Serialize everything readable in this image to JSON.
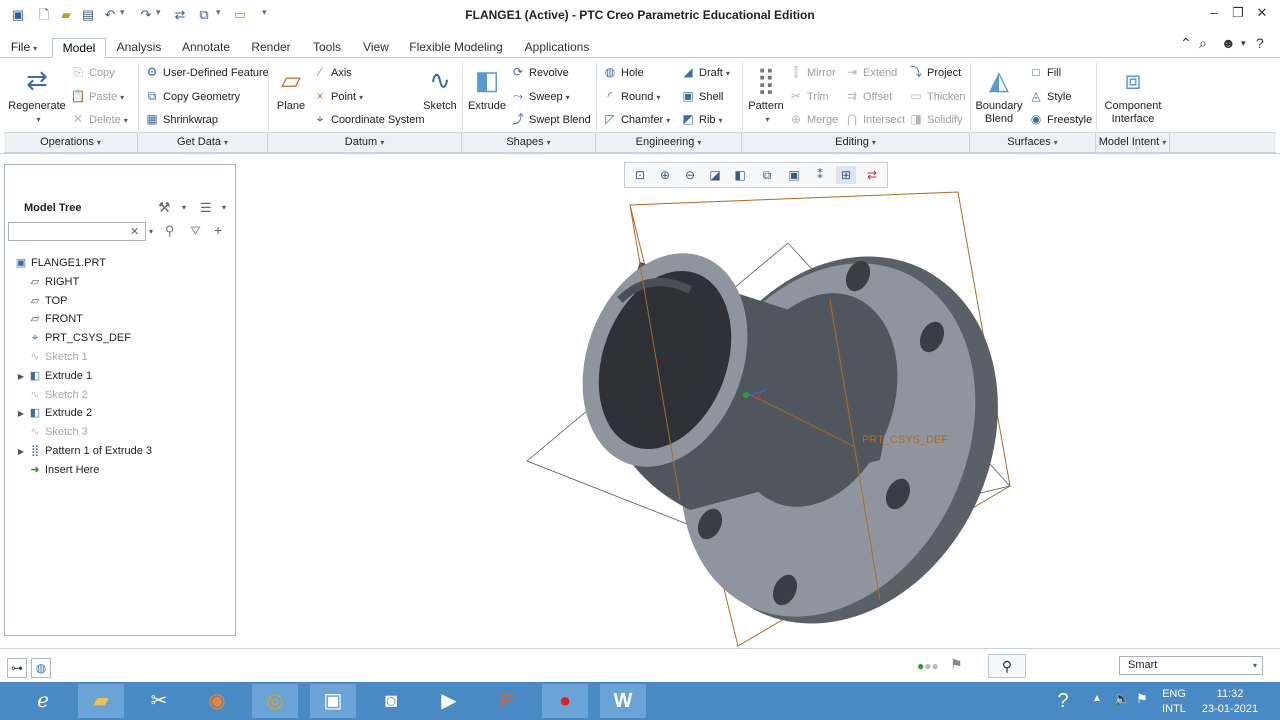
{
  "window": {
    "title": "FLANGE1 (Active) - PTC Creo Parametric Educational Edition"
  },
  "menu": {
    "file": "File"
  },
  "tabs": [
    "Model",
    "Analysis",
    "Annotate",
    "Render",
    "Tools",
    "View",
    "Flexible Modeling",
    "Applications"
  ],
  "ribbon": {
    "operations": {
      "regenerate": "Regenerate",
      "copy": "Copy",
      "paste": "Paste",
      "delete": "Delete"
    },
    "get_data": {
      "udf": "User-Defined Feature",
      "copy_geometry": "Copy Geometry",
      "shrinkwrap": "Shrinkwrap"
    },
    "datum": {
      "plane": "Plane",
      "axis": "Axis",
      "point": "Point",
      "csys": "Coordinate System",
      "sketch": "Sketch"
    },
    "shapes": {
      "extrude": "Extrude",
      "revolve": "Revolve",
      "sweep": "Sweep",
      "swept_blend": "Swept Blend"
    },
    "engineering": {
      "hole": "Hole",
      "round": "Round",
      "chamfer": "Chamfer",
      "draft": "Draft",
      "shell": "Shell",
      "rib": "Rib"
    },
    "editing": {
      "pattern": "Pattern",
      "mirror": "Mirror",
      "trim": "Trim",
      "merge": "Merge",
      "extend": "Extend",
      "offset": "Offset",
      "intersect": "Intersect",
      "project": "Project",
      "thicken": "Thicken",
      "solidify": "Solidify"
    },
    "surfaces": {
      "boundary_blend_1": "Boundary",
      "boundary_blend_2": "Blend",
      "fill": "Fill",
      "style": "Style",
      "freestyle": "Freestyle"
    },
    "model_intent": {
      "component_interface_1": "Component",
      "component_interface_2": "Interface"
    }
  },
  "groups": [
    "Operations",
    "Get Data",
    "Datum",
    "Shapes",
    "Engineering",
    "Editing",
    "Surfaces",
    "Model Intent"
  ],
  "model_tree": {
    "label": "Model Tree",
    "search_value": "",
    "items": [
      {
        "label": "FLANGE1.PRT",
        "icon": "part-icon",
        "dim": false,
        "expandable": false
      },
      {
        "label": "RIGHT",
        "icon": "datum-plane-icon",
        "dim": false,
        "expandable": false
      },
      {
        "label": "TOP",
        "icon": "datum-plane-icon",
        "dim": false,
        "expandable": false
      },
      {
        "label": "FRONT",
        "icon": "datum-plane-icon",
        "dim": false,
        "expandable": false
      },
      {
        "label": "PRT_CSYS_DEF",
        "icon": "csys-icon",
        "dim": false,
        "expandable": false
      },
      {
        "label": "Sketch 1",
        "icon": "sketch-icon",
        "dim": true,
        "expandable": false
      },
      {
        "label": "Extrude 1",
        "icon": "extrude-icon",
        "dim": false,
        "expandable": true
      },
      {
        "label": "Sketch 2",
        "icon": "sketch-icon",
        "dim": true,
        "expandable": false
      },
      {
        "label": "Extrude 2",
        "icon": "extrude-icon",
        "dim": false,
        "expandable": true
      },
      {
        "label": "Sketch 3",
        "icon": "sketch-icon",
        "dim": true,
        "expandable": false
      },
      {
        "label": "Pattern 1 of Extrude 3",
        "icon": "pattern-icon",
        "dim": false,
        "expandable": true
      },
      {
        "label": "Insert Here",
        "icon": "insert-arrow-icon",
        "dim": false,
        "expandable": false
      }
    ]
  },
  "viewport": {
    "csys_label": "PRT_CSYS_DEF"
  },
  "status": {
    "selection_filter": "Smart"
  },
  "taskbar": {
    "lang_1": "ENG",
    "lang_2": "INTL",
    "time": "11:32",
    "date": "23-01-2021"
  },
  "colors": {
    "taskbar": "#4a8ac4",
    "part_gray": "#8a9098",
    "datum_orange": "#c07830"
  }
}
